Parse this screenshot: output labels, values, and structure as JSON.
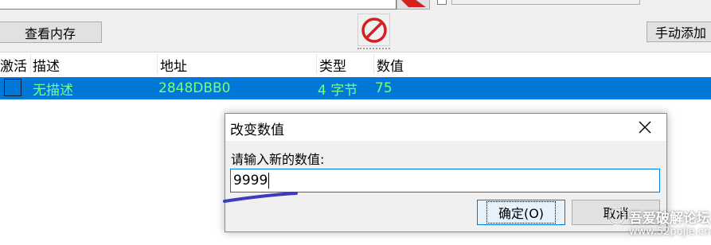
{
  "toolbar": {
    "view_memory_label": "查看内存",
    "add_manual_label": "手动添加"
  },
  "table": {
    "headers": {
      "active": "激活",
      "description": "描述",
      "address": "地址",
      "type": "类型",
      "value": "数值"
    },
    "rows": [
      {
        "active": false,
        "description": "无描述",
        "address": "2848DBB0",
        "type": "4 字节",
        "value": "75"
      }
    ]
  },
  "dialog": {
    "title": "改变数值",
    "prompt": "请输入新的数值:",
    "input_value": "9999",
    "ok_label": "确定(O)",
    "cancel_label": "取消"
  },
  "watermark": {
    "text": "吾爱破解论坛",
    "url": "www.52pojie.cn"
  },
  "colors": {
    "selection": "#0078d7",
    "row_text": "#79ff79",
    "annotation_stroke": "#3b3bc0",
    "stop_icon": "#d42020"
  }
}
